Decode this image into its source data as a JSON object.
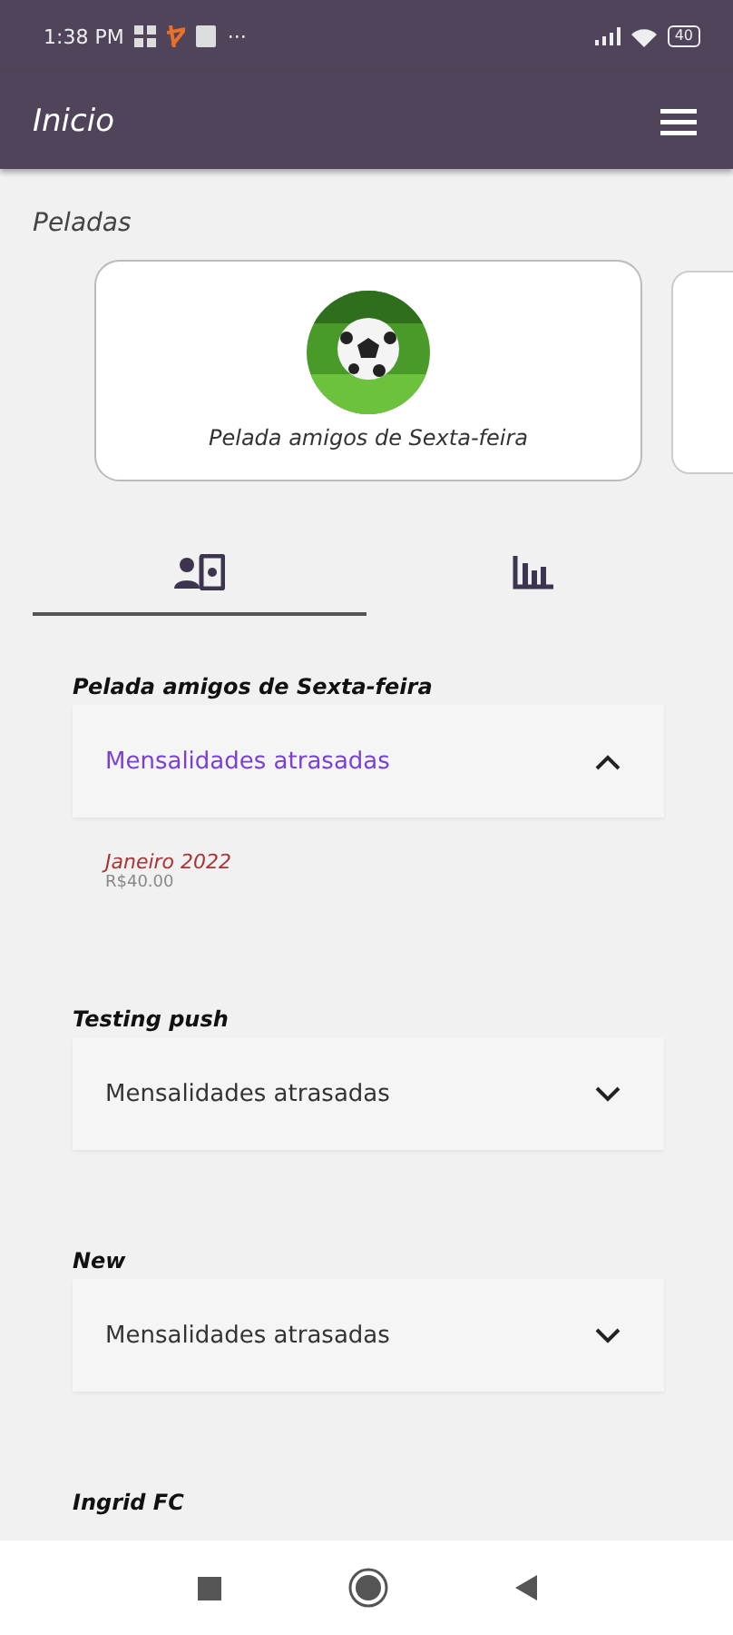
{
  "status_bar": {
    "time": "1:38 PM",
    "more": "···",
    "battery": "40"
  },
  "app_bar": {
    "title": "Inicio"
  },
  "section_title": "Peladas",
  "cards": [
    {
      "name": "Pelada amigos de Sexta-feira"
    }
  ],
  "tabs": [
    {
      "kind": "members",
      "selected": true
    },
    {
      "kind": "chart",
      "selected": false
    }
  ],
  "groups": [
    {
      "title": "Pelada amigos de Sexta-feira",
      "panel": "Mensalidades atrasadas",
      "expanded": true,
      "items": [
        {
          "month": "Janeiro 2022",
          "amount": "R$40.00"
        }
      ]
    },
    {
      "title": "Testing push",
      "panel": "Mensalidades atrasadas",
      "expanded": false
    },
    {
      "title": "New",
      "panel": "Mensalidades atrasadas",
      "expanded": false
    },
    {
      "title": "Ingrid FC",
      "kind": "cut"
    }
  ]
}
